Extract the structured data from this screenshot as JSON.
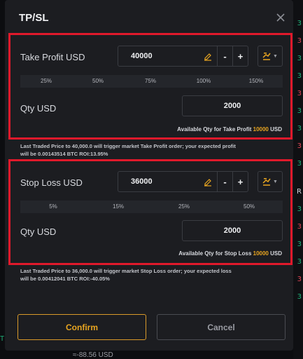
{
  "dialog": {
    "title": "TP/SL"
  },
  "take_profit": {
    "label": "Take Profit USD",
    "value": "40000",
    "minus": "-",
    "plus": "+",
    "percentages": [
      "25%",
      "50%",
      "75%",
      "100%",
      "150%"
    ],
    "qty_label": "Qty USD",
    "qty_value": "2000",
    "avail_prefix": "Available Qty for Take Profit",
    "avail_amount": "10000",
    "avail_suffix": "USD",
    "note_line1": "Last Traded Price to 40,000.0 will trigger market Take Profit order; your expected profit",
    "note_line2": "will be 0.00143514 BTC  ROI:13.95%"
  },
  "stop_loss": {
    "label": "Stop Loss  USD",
    "value": "36000",
    "minus": "-",
    "plus": "+",
    "percentages": [
      "5%",
      "15%",
      "25%",
      "50%"
    ],
    "qty_label": "Qty USD",
    "qty_value": "2000",
    "avail_prefix": "Available Qty for Stop Loss",
    "avail_amount": "10000",
    "avail_suffix": "USD",
    "note_line1": "Last Traded Price to 36,000.0 will trigger market Stop Loss order; your expected loss",
    "note_line2": "will be 0.00412041 BTC  ROI:-40.05%"
  },
  "buttons": {
    "confirm": "Confirm",
    "cancel": "Cancel"
  },
  "background": {
    "footer_text": "≈-88.56 USD",
    "right_digits": [
      "3",
      "3",
      "3",
      "3",
      "3",
      "3",
      "3",
      "3",
      "3",
      "3",
      "3",
      "3",
      "3",
      "3",
      "3"
    ],
    "right_letter": "R",
    "left_letter": "T"
  },
  "colors": {
    "accent": "#e8a520",
    "highlight_border": "#e0192b",
    "green": "#1fb37a",
    "red": "#e04656"
  },
  "icons": {
    "close": "close-icon",
    "pencil": "pencil-icon",
    "order_mode": "order-mode-icon",
    "dropdown": "chevron-down-icon"
  }
}
